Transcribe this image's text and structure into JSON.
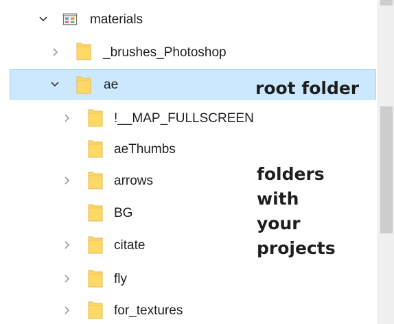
{
  "tree": {
    "root": {
      "label": "materials",
      "icon": "folder-view-icon",
      "expanded": true
    },
    "items": [
      {
        "label": "_brushes_Photoshop",
        "expandable": true,
        "level": 1
      },
      {
        "label": "ae",
        "expandable": true,
        "expanded": true,
        "selected": true,
        "level": 1
      },
      {
        "label": "!__MAP_FULLSCREEN",
        "expandable": true,
        "level": 2
      },
      {
        "label": "aeThumbs",
        "expandable": false,
        "level": 2
      },
      {
        "label": "arrows",
        "expandable": true,
        "level": 2
      },
      {
        "label": "BG",
        "expandable": false,
        "level": 2
      },
      {
        "label": "citate",
        "expandable": true,
        "level": 2
      },
      {
        "label": "fly",
        "expandable": true,
        "level": 2
      },
      {
        "label": "for_textures",
        "expandable": true,
        "level": 2
      }
    ]
  },
  "annotations": {
    "root_note": "root folder",
    "projects_note": [
      "folders",
      "with",
      "your",
      "projects"
    ]
  },
  "colors": {
    "selection_bg": "#cce8ff",
    "selection_border": "#99d1ff",
    "folder_yellow": "#ffd966",
    "folder_edge": "#e8b64a",
    "text": "#1e1e1e",
    "scrollbar_thumb": "#cdcdcd"
  }
}
